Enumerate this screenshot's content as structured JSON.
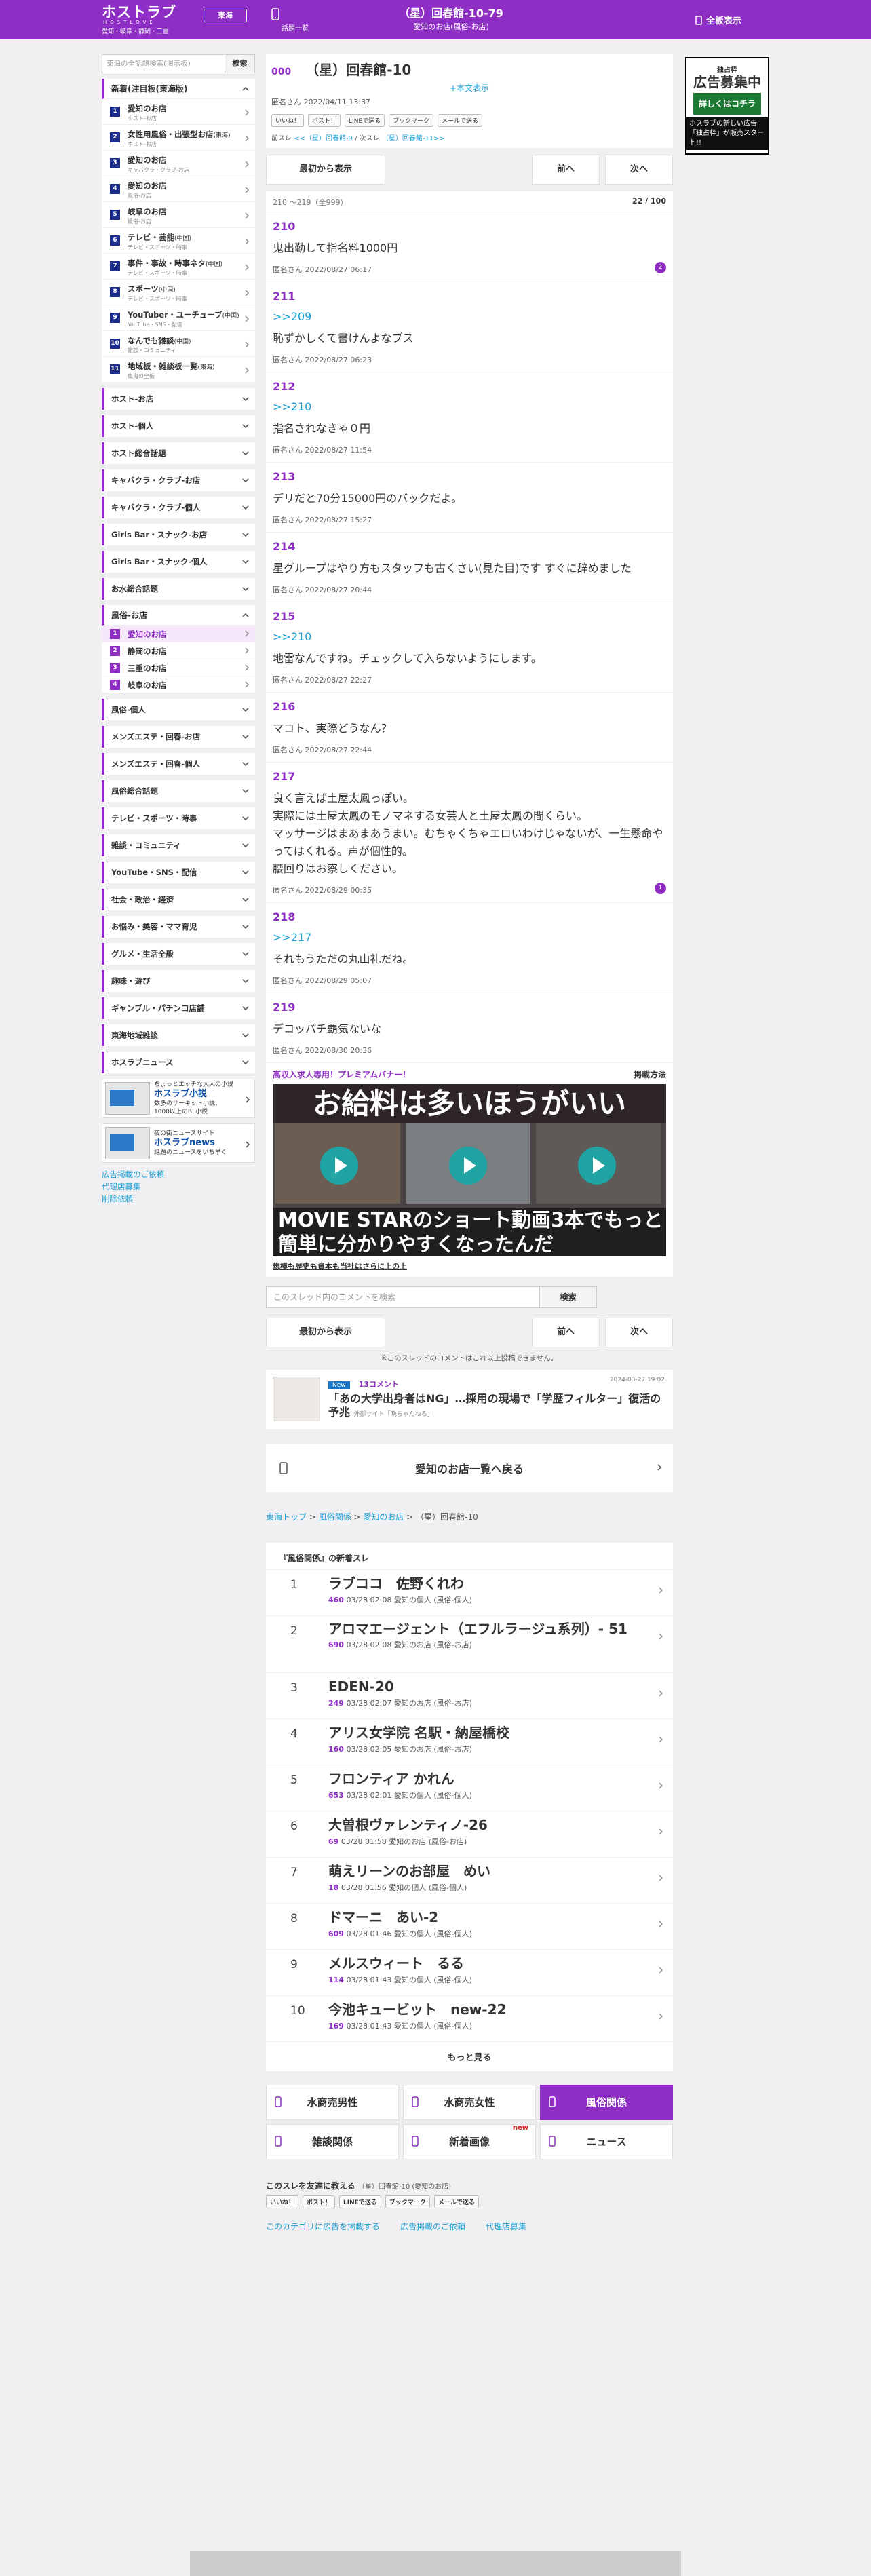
{
  "header": {
    "logo_main": "ホストラブ",
    "logo_sub": "HOSTLOVE",
    "logo_regions": "愛知・岐阜・静岡・三重",
    "region_button": "東海",
    "list_label": "話題一覧",
    "thread_title": "（星）回春館-10-79",
    "thread_sub": "愛知のお店(風俗-お店)",
    "fullscreen_label": "全板表示"
  },
  "sidebar": {
    "search_placeholder": "東海の全話題検索(掲示板)",
    "search_button": "検索",
    "section_title": "新着(注目板(東海版)",
    "items": [
      {
        "num": "1",
        "label": "愛知のお店",
        "tag": "",
        "sub": "ホスト-お店"
      },
      {
        "num": "2",
        "label": "女性用風俗・出張型お店",
        "tag": "(東海)",
        "sub": "ホスト-お店"
      },
      {
        "num": "3",
        "label": "愛知のお店",
        "tag": "",
        "sub": "キャバクラ・クラブ-お店"
      },
      {
        "num": "4",
        "label": "愛知のお店",
        "tag": "",
        "sub": "風俗-お店"
      },
      {
        "num": "5",
        "label": "岐阜のお店",
        "tag": "",
        "sub": "風俗-お店"
      },
      {
        "num": "6",
        "label": "テレビ・芸能",
        "tag": "(中国)",
        "sub": "テレビ・スポーツ・時事"
      },
      {
        "num": "7",
        "label": "事件・事故・時事ネタ",
        "tag": "(中国)",
        "sub": "テレビ・スポーツ・時事"
      },
      {
        "num": "8",
        "label": "スポーツ",
        "tag": "(中国)",
        "sub": "テレビ・スポーツ・時事"
      },
      {
        "num": "9",
        "label": "YouTuber・ユーチューブ",
        "tag": "(中国)",
        "sub": "YouTube・SNS・配信"
      },
      {
        "num": "10",
        "label": "なんでも雑談",
        "tag": "(中国)",
        "sub": "雑談・コミュニティ"
      },
      {
        "num": "11",
        "label": "地域板・雑談板一覧",
        "tag": "(東海)",
        "sub": "東海の全板"
      }
    ],
    "cats_a": [
      "ホスト-お店",
      "ホスト-個人",
      "ホスト総合話題",
      "キャバクラ・クラブ-お店",
      "キャバクラ・クラブ-個人",
      "Girls Bar・スナック-お店",
      "Girls Bar・スナック-個人",
      "お水総合話題"
    ],
    "fuzoku_title": "風俗-お店",
    "fuzoku_items": [
      {
        "num": "1",
        "label": "愛知のお店"
      },
      {
        "num": "2",
        "label": "静岡のお店"
      },
      {
        "num": "3",
        "label": "三重のお店"
      },
      {
        "num": "4",
        "label": "岐阜のお店"
      }
    ],
    "cats_b": [
      "風俗-個人",
      "メンズエステ・回春-お店",
      "メンズエステ・回春-個人",
      "風俗総合話題",
      "テレビ・スポーツ・時事",
      "雑談・コミュニティ",
      "YouTube・SNS・配信",
      "社会・政治・経済",
      "お悩み・美容・ママ育児",
      "グルメ・生活全般",
      "趣味・遊び",
      "ギャンブル・パチンコ店舗",
      "東海地域雑談",
      "ホスラブニュース"
    ],
    "banner1_small": "ちょっとエッチな大人の小説",
    "banner1_title": "ホスラブ小説",
    "banner1_sub": "数多のサーキット小説、1000以上のBL小説",
    "banner2_small": "夜の街ニュースサイト",
    "banner2_title": "ホスラブnews",
    "banner2_sub": "話題のニュースをいち早く",
    "links": [
      "広告掲載のご依頼",
      "代理店募集",
      "削除依頼"
    ]
  },
  "thread": {
    "number": "000",
    "title": "（星）回春館-10",
    "show_body": "+本文表示",
    "author": "匿名さん",
    "date": "2022/04/11 13:37",
    "share": [
      "いいね！",
      "ポスト！",
      "LINEで送る",
      "ブックマーク",
      "メールで送る"
    ],
    "prev_label": "前スレ",
    "prev_link": "<<（星）回春館-9",
    "next_label": "次スレ",
    "next_link": "（星）回春館-11>>",
    "first_button": "最初から表示",
    "prev_button": "前へ",
    "next_button": "次へ",
    "range": "210 〜219（全999）",
    "page": "22 / 100"
  },
  "posts": [
    {
      "no": "210",
      "anchor": "",
      "body": "鬼出勤して指名料1000円",
      "author": "匿名さん",
      "date": "2022/08/27 06:17",
      "badge": "2"
    },
    {
      "no": "211",
      "anchor": ">>209",
      "body": "恥ずかしくて書けんよなブス",
      "author": "匿名さん",
      "date": "2022/08/27 06:23",
      "badge": ""
    },
    {
      "no": "212",
      "anchor": ">>210",
      "body": "指名されなきゃ０円",
      "author": "匿名さん",
      "date": "2022/08/27 11:54",
      "badge": ""
    },
    {
      "no": "213",
      "anchor": "",
      "body": "デリだと70分15000円のバックだよ。",
      "author": "匿名さん",
      "date": "2022/08/27 15:27",
      "badge": ""
    },
    {
      "no": "214",
      "anchor": "",
      "body": "星グループはやり方もスタッフも古くさい(見た目)です すぐに辞めました",
      "author": "匿名さん",
      "date": "2022/08/27 20:44",
      "badge": ""
    },
    {
      "no": "215",
      "anchor": ">>210",
      "body": "地雷なんですね。チェックして入らないようにします。",
      "author": "匿名さん",
      "date": "2022/08/27 22:27",
      "badge": ""
    },
    {
      "no": "216",
      "anchor": "",
      "body": "マコト、実際どうなん？",
      "author": "匿名さん",
      "date": "2022/08/27 22:44",
      "badge": ""
    },
    {
      "no": "217",
      "anchor": "",
      "body": "良く言えば土屋太鳳っぽい。\n実際には土屋太鳳のモノマネする女芸人と土屋太鳳の間くらい。\nマッサージはまあまあうまい。むちゃくちゃエロいわけじゃないが、一生懸命やってはくれる。声が個性的。\n腰回りはお察しください。",
      "author": "匿名さん",
      "date": "2022/08/29 00:35",
      "badge": "1"
    },
    {
      "no": "218",
      "anchor": ">>217",
      "body": "それもうただの丸山礼だね。",
      "author": "匿名さん",
      "date": "2022/08/29 05:07",
      "badge": ""
    },
    {
      "no": "219",
      "anchor": "",
      "body": "デコッパチ覇気ないな",
      "author": "匿名さん",
      "date": "2022/08/30 20:36",
      "badge": ""
    }
  ],
  "premium": {
    "label": "高収入求人専用！プレミアムバナー！",
    "howto": "掲載方法",
    "top_text": "お給料は多いほうがいい",
    "bottom_text": "MOVIE STARのショート動画3本でもっと簡単に分かりやすくなったんだ",
    "caption": "規模も歴史も資本も当社はさらに上の上"
  },
  "comment_search": {
    "placeholder": "このスレッド内のコメントを検索",
    "button": "検索"
  },
  "limit_note": "※このスレッドのコメントはこれ以上投稿できません。",
  "news": {
    "badge": "New",
    "comments": "13コメント",
    "date": "2024-03-27 19:02",
    "title": "「あの大学出身者はNG」…採用の現場で「学歴フィルター」復活の予兆",
    "source": "外部サイト「晩ちゃんねる」"
  },
  "back_button": "愛知のお店一覧へ戻る",
  "breadcrumb": {
    "items": [
      "東海トップ",
      "風俗関係",
      "愛知のお店"
    ],
    "current": "（星）回春館-10"
  },
  "ranking": {
    "title": "『風俗関係』の新着スレ",
    "rows": [
      {
        "rank": "1",
        "title": "ラブココ　佐野くれわ",
        "count": "460",
        "date": "03/28 02:08",
        "cat": "愛知の個人 (風俗-個人)"
      },
      {
        "rank": "2",
        "title": "アロマエージェント（エフルラージュ系列）- 51",
        "count": "690",
        "date": "03/28 02:08",
        "cat": "愛知のお店 (風俗-お店)"
      },
      {
        "rank": "3",
        "title": "EDEN-20",
        "count": "249",
        "date": "03/28 02:07",
        "cat": "愛知のお店 (風俗-お店)"
      },
      {
        "rank": "4",
        "title": "アリス女学院 名駅・納屋橋校",
        "count": "160",
        "date": "03/28 02:05",
        "cat": "愛知のお店 (風俗-お店)"
      },
      {
        "rank": "5",
        "title": "フロンティア かれん",
        "count": "653",
        "date": "03/28 02:01",
        "cat": "愛知の個人 (風俗-個人)"
      },
      {
        "rank": "6",
        "title": "大曽根ヴァレンティノ-26",
        "count": "69",
        "date": "03/28 01:58",
        "cat": "愛知のお店 (風俗-お店)"
      },
      {
        "rank": "7",
        "title": "萌えリーンのお部屋　めい",
        "count": "18",
        "date": "03/28 01:56",
        "cat": "愛知の個人 (風俗-個人)"
      },
      {
        "rank": "8",
        "title": "ドマーニ　あい-2",
        "count": "609",
        "date": "03/28 01:46",
        "cat": "愛知の個人 (風俗-個人)"
      },
      {
        "rank": "9",
        "title": "メルスウィート　るる",
        "count": "114",
        "date": "03/28 01:43",
        "cat": "愛知の個人 (風俗-個人)"
      },
      {
        "rank": "10",
        "title": "今池キュービット　new-22",
        "count": "169",
        "date": "03/28 01:43",
        "cat": "愛知の個人 (風俗-個人)"
      }
    ],
    "more": "もっと見る"
  },
  "categories": [
    {
      "label": "水商売男性",
      "active": false
    },
    {
      "label": "水商売女性",
      "active": false
    },
    {
      "label": "風俗関係",
      "active": true
    },
    {
      "label": "雑談関係",
      "active": false
    },
    {
      "label": "新着画像",
      "active": false
    },
    {
      "label": "ニュース",
      "active": false
    }
  ],
  "new_tag": "new",
  "friend": {
    "label": "このスレを友達に教える",
    "thread": "（星）回春館-10 (愛知のお店)"
  },
  "footer_links": [
    "このカテゴリに広告を掲載する",
    "広告掲載のご依頼",
    "代理店募集"
  ],
  "ad": {
    "top": "独占枠",
    "title": "広告募集中",
    "cta": "詳しくはコチラ",
    "note": "ホスラブの新しい広告「独占枠」が販売スタート!!"
  },
  "colors": {
    "brand": "#8e2ec4",
    "link": "#1a9fd6",
    "rank_num_bg": "#1c2c8a"
  }
}
